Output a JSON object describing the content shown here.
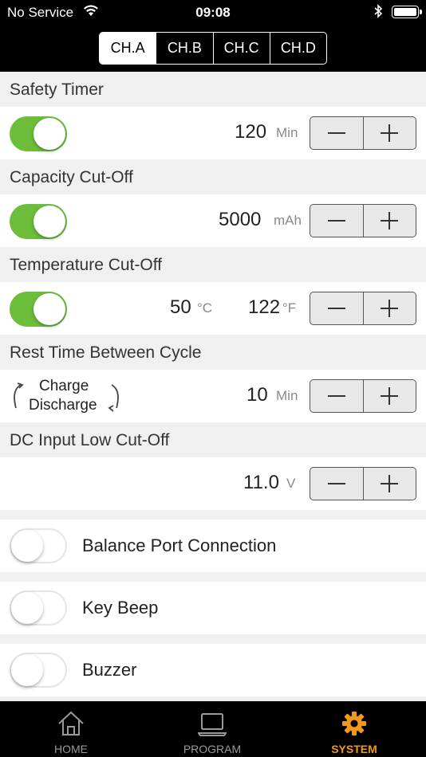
{
  "status_bar": {
    "carrier": "No Service",
    "time": "09:08"
  },
  "channels": [
    "CH.A",
    "CH.B",
    "CH.C",
    "CH.D"
  ],
  "selected_channel": "CH.A",
  "sections": {
    "safety_timer": {
      "title": "Safety Timer",
      "enabled": true,
      "value": "120",
      "unit": "Min"
    },
    "capacity_cutoff": {
      "title": "Capacity Cut-Off",
      "enabled": true,
      "value": "5000",
      "unit": "mAh"
    },
    "temperature_cutoff": {
      "title": "Temperature Cut-Off",
      "enabled": true,
      "celsius": "50",
      "celsius_unit": "°C",
      "fahrenheit": "122",
      "fahrenheit_unit": "°F"
    },
    "rest_time": {
      "title": "Rest Time Between Cycle",
      "line1": "Charge",
      "line2": "Discharge",
      "value": "10",
      "unit": "Min"
    },
    "dc_input": {
      "title": "DC Input Low Cut-Off",
      "value": "11.0",
      "unit": "V"
    }
  },
  "switches": [
    {
      "label": "Balance Port Connection",
      "enabled": false
    },
    {
      "label": "Key Beep",
      "enabled": false
    },
    {
      "label": "Buzzer",
      "enabled": false
    }
  ],
  "tabbar": {
    "home": "HOME",
    "program": "PROGRAM",
    "system": "SYSTEM",
    "active": "SYSTEM"
  },
  "colors": {
    "toggle_on": "#6cbd3a",
    "active_tab": "#f29a18",
    "bar_background": "#000000"
  },
  "icons": {
    "wifi": "wifi-icon",
    "bluetooth": "bluetooth-icon",
    "battery": "battery-icon",
    "home": "home-icon",
    "program": "laptop-icon",
    "system": "gear-icon",
    "cycle": "cycle-arrows-icon"
  }
}
